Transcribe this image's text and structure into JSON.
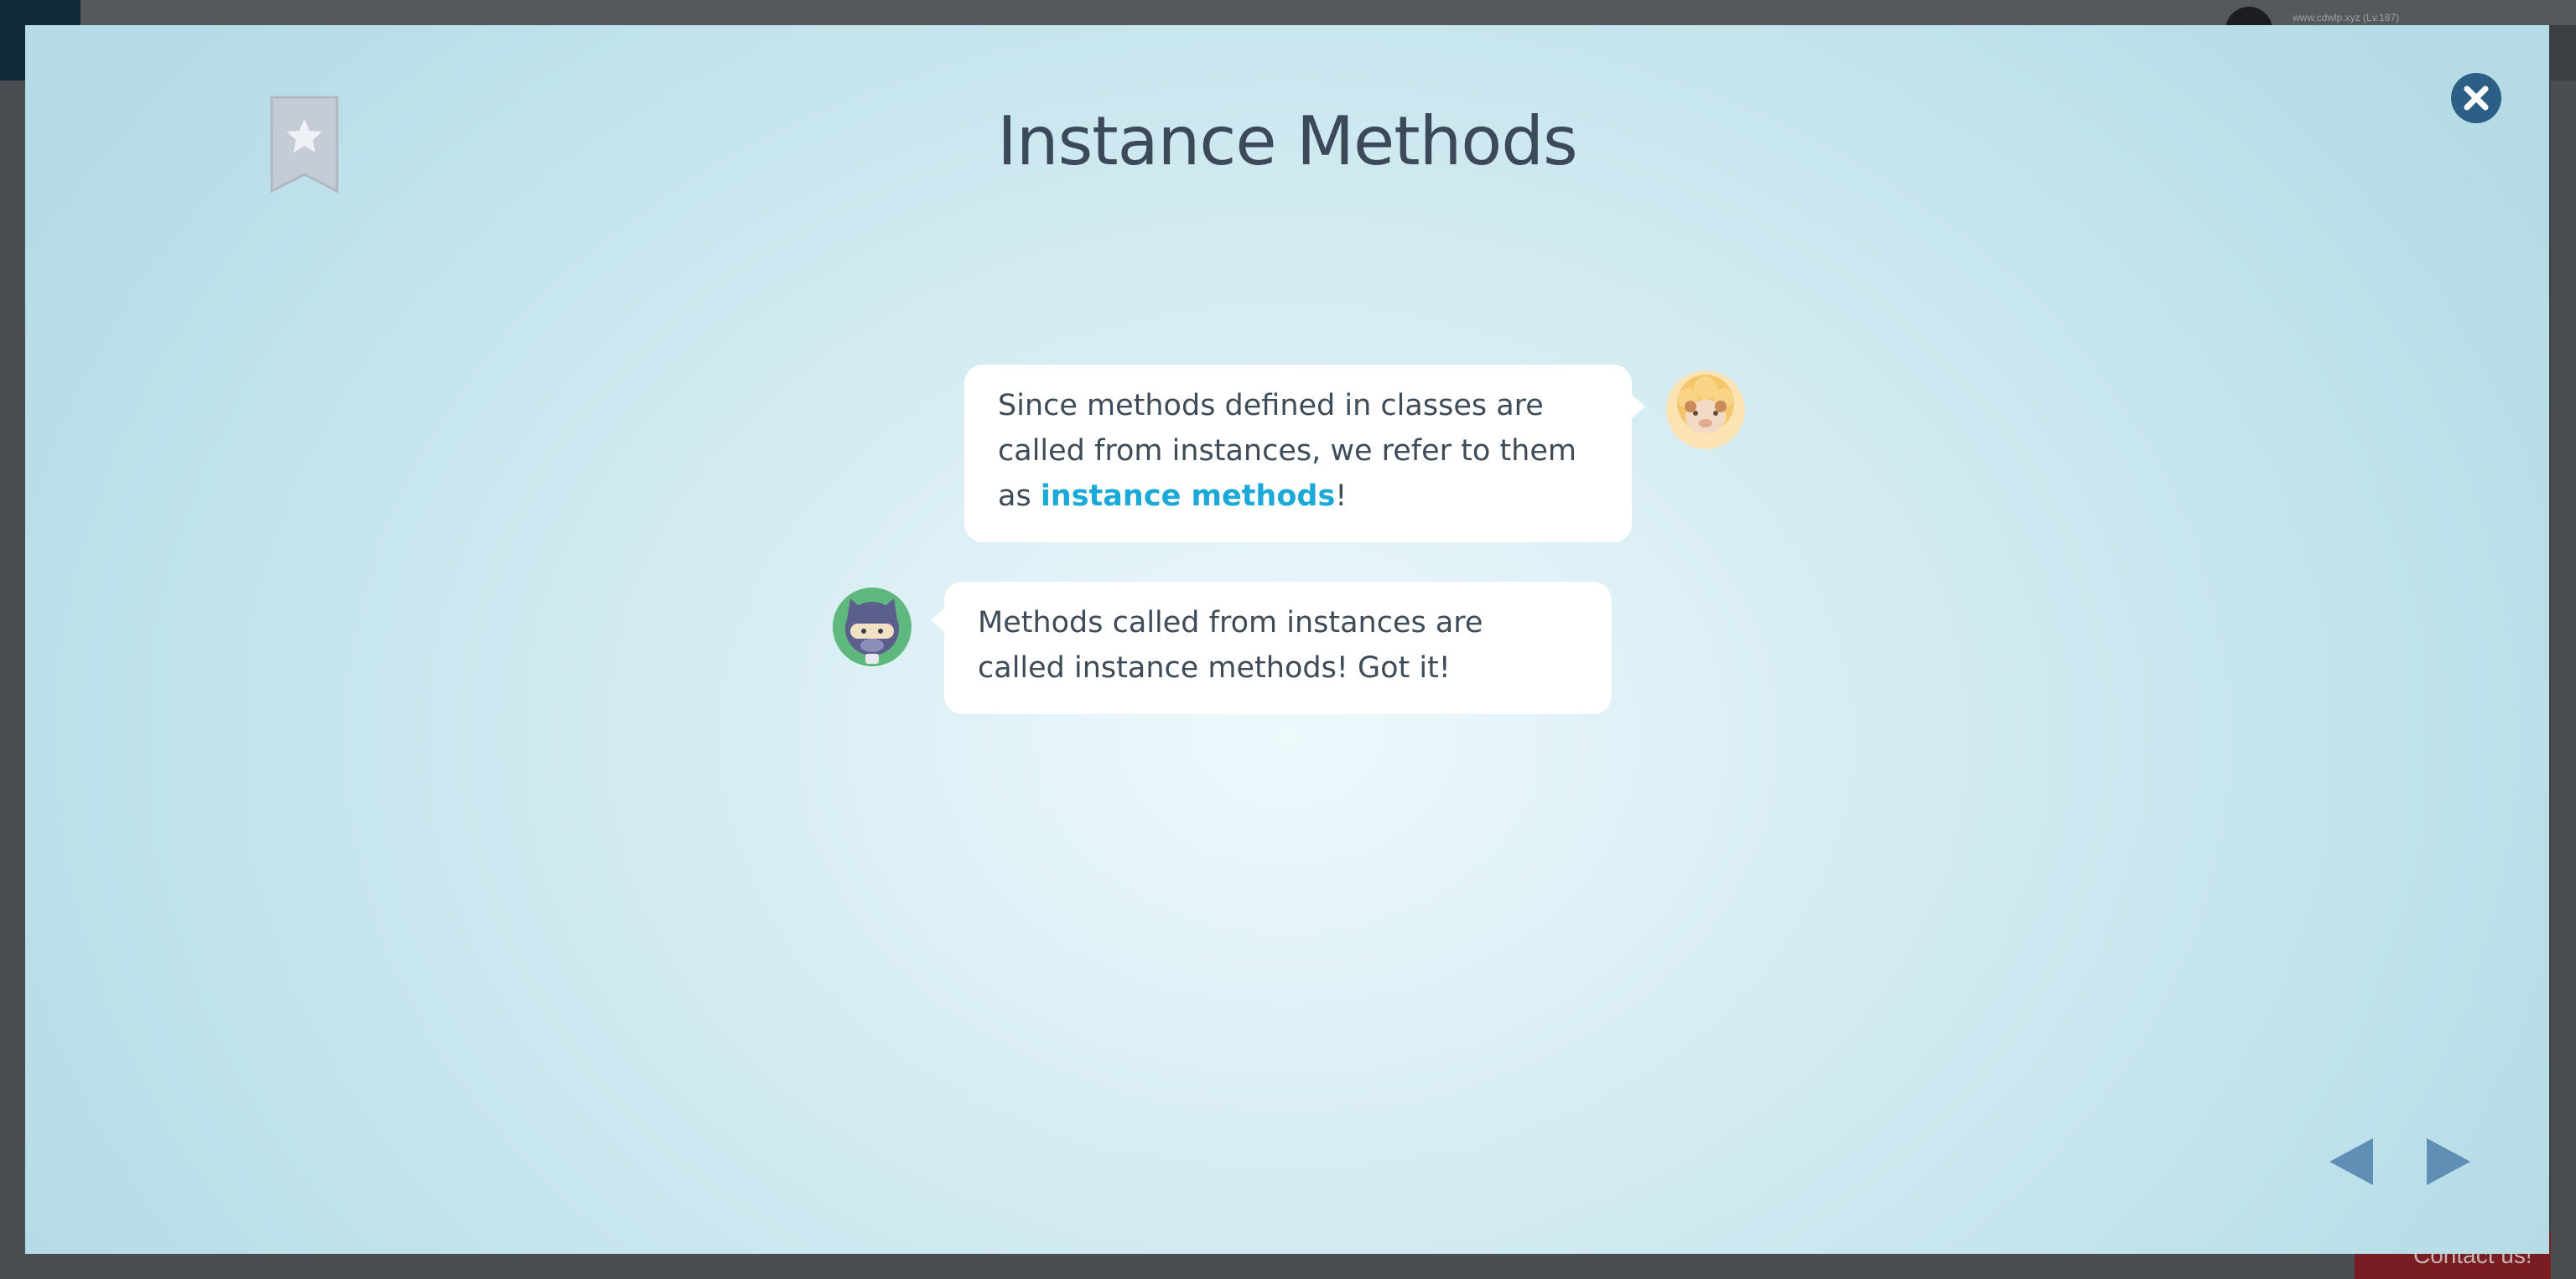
{
  "background": {
    "user_label": "www.cdwlp.xyz (Lv.187)",
    "contact_label": "Contact us!"
  },
  "modal": {
    "title": "Instance Methods",
    "bookmark_icon": "bookmark-star-icon",
    "close_icon": "close-icon"
  },
  "dialogue": [
    {
      "speaker_icon": "sheep-avatar-icon",
      "text_before": "Since methods defined in classes are called from instances, we refer to them as ",
      "highlight": "instance methods",
      "text_after": "!"
    },
    {
      "speaker_icon": "ninja-cat-avatar-icon",
      "text": "Methods called from instances are called instance methods! Got it!"
    }
  ],
  "navigation": {
    "prev_icon": "triangle-left-icon",
    "next_icon": "triangle-right-icon"
  },
  "colors": {
    "accent": "#1ba9d8",
    "text": "#3e4b58",
    "nav": "#5f8fb4",
    "close": "#2b5f85"
  }
}
